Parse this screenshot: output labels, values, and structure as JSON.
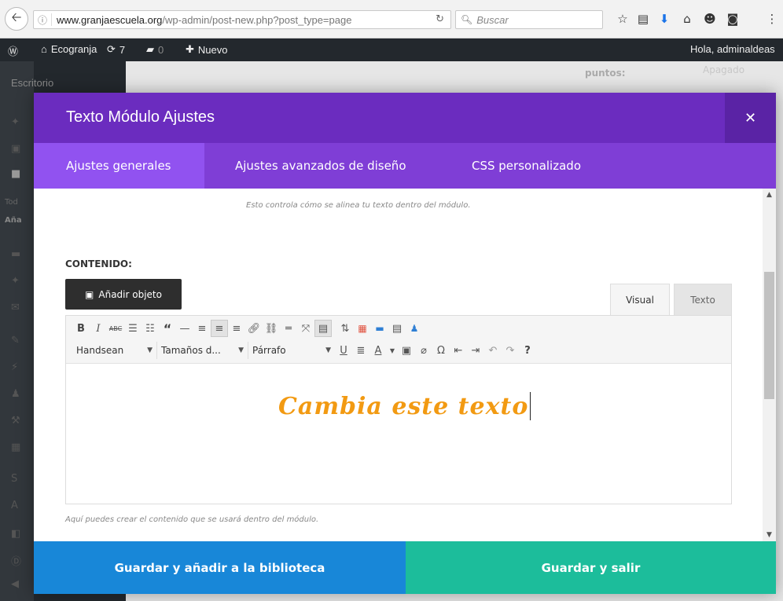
{
  "browser": {
    "url_host": "www.granjaescuela.org",
    "url_path": "/wp-admin/post-new.php?post_type=page",
    "search_placeholder": "Buscar"
  },
  "admin_bar": {
    "site_name": "Ecogranja",
    "updates_count": "7",
    "comments_count": "0",
    "new_label": "Nuevo",
    "greeting": "Hola, adminaldeas"
  },
  "background": {
    "sidebar_item": "Escritorio",
    "field_label": "puntos:",
    "field_value": "Apagado",
    "sidebar_text_1": "Tod",
    "sidebar_text_2": "Aña"
  },
  "modal": {
    "title": "Texto Módulo Ajustes",
    "tabs": [
      {
        "label": "Ajustes generales"
      },
      {
        "label": "Ajustes avanzados de diseño"
      },
      {
        "label": "CSS personalizado"
      }
    ],
    "help_alignment": "Esto controla cómo se alinea tu texto dentro del módulo.",
    "content_label": "CONTENIDO:",
    "add_object_label": "Añadir objeto",
    "editor_tabs": {
      "visual": "Visual",
      "text": "Texto"
    },
    "font_select": "Handsean",
    "size_select": "Tamaños d...",
    "format_select": "Párrafo",
    "editor_text": "Cambia este texto",
    "help_content": "Aquí puedes crear el contenido que se usará dentro del módulo.",
    "btn_library": "Guardar y añadir a la biblioteca",
    "btn_save": "Guardar y salir"
  },
  "colors": {
    "modal_header": "#6b2cbf",
    "tabs_bar": "#7f3ed6",
    "active_tab": "#9152f0",
    "library_button": "#1887d8",
    "save_button": "#1cbd9b",
    "editor_text": "#f29a12"
  }
}
